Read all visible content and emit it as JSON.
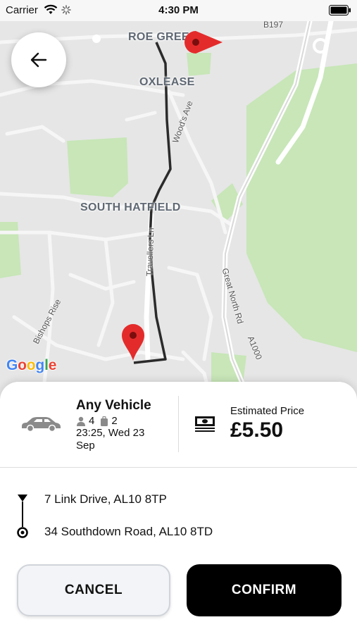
{
  "status_bar": {
    "carrier": "Carrier",
    "time": "4:30 PM"
  },
  "map": {
    "labels": {
      "roe_green": "ROE GREEN",
      "oxlease": "OXLEASE",
      "south_hatfield": "SOUTH HATFIELD"
    },
    "roads": {
      "b197": "B197",
      "woods_ave": "Wood's Ave",
      "travellers_ln": "Travellers Ln",
      "great_north_rd": "Great North Rd",
      "a1000": "A1000",
      "bishops_rise": "Bishops Rise"
    },
    "attribution": "Google",
    "icons": {
      "back": "arrow-left-icon",
      "pin": "map-pin-icon"
    },
    "colors": {
      "pin": "#e42b2b",
      "route": "#2b2b2b",
      "park": "#c8e6b8"
    }
  },
  "trip": {
    "vehicle_name": "Any Vehicle",
    "passengers": "4",
    "luggage": "2",
    "datetime": "23:25, Wed 23 Sep",
    "price_label": "Estimated Price",
    "price": "£5.50",
    "pickup": "7 Link Drive, AL10 8TP",
    "dropoff": "34 Southdown Road, AL10 8TD"
  },
  "actions": {
    "cancel_label": "CANCEL",
    "confirm_label": "CONFIRM"
  }
}
